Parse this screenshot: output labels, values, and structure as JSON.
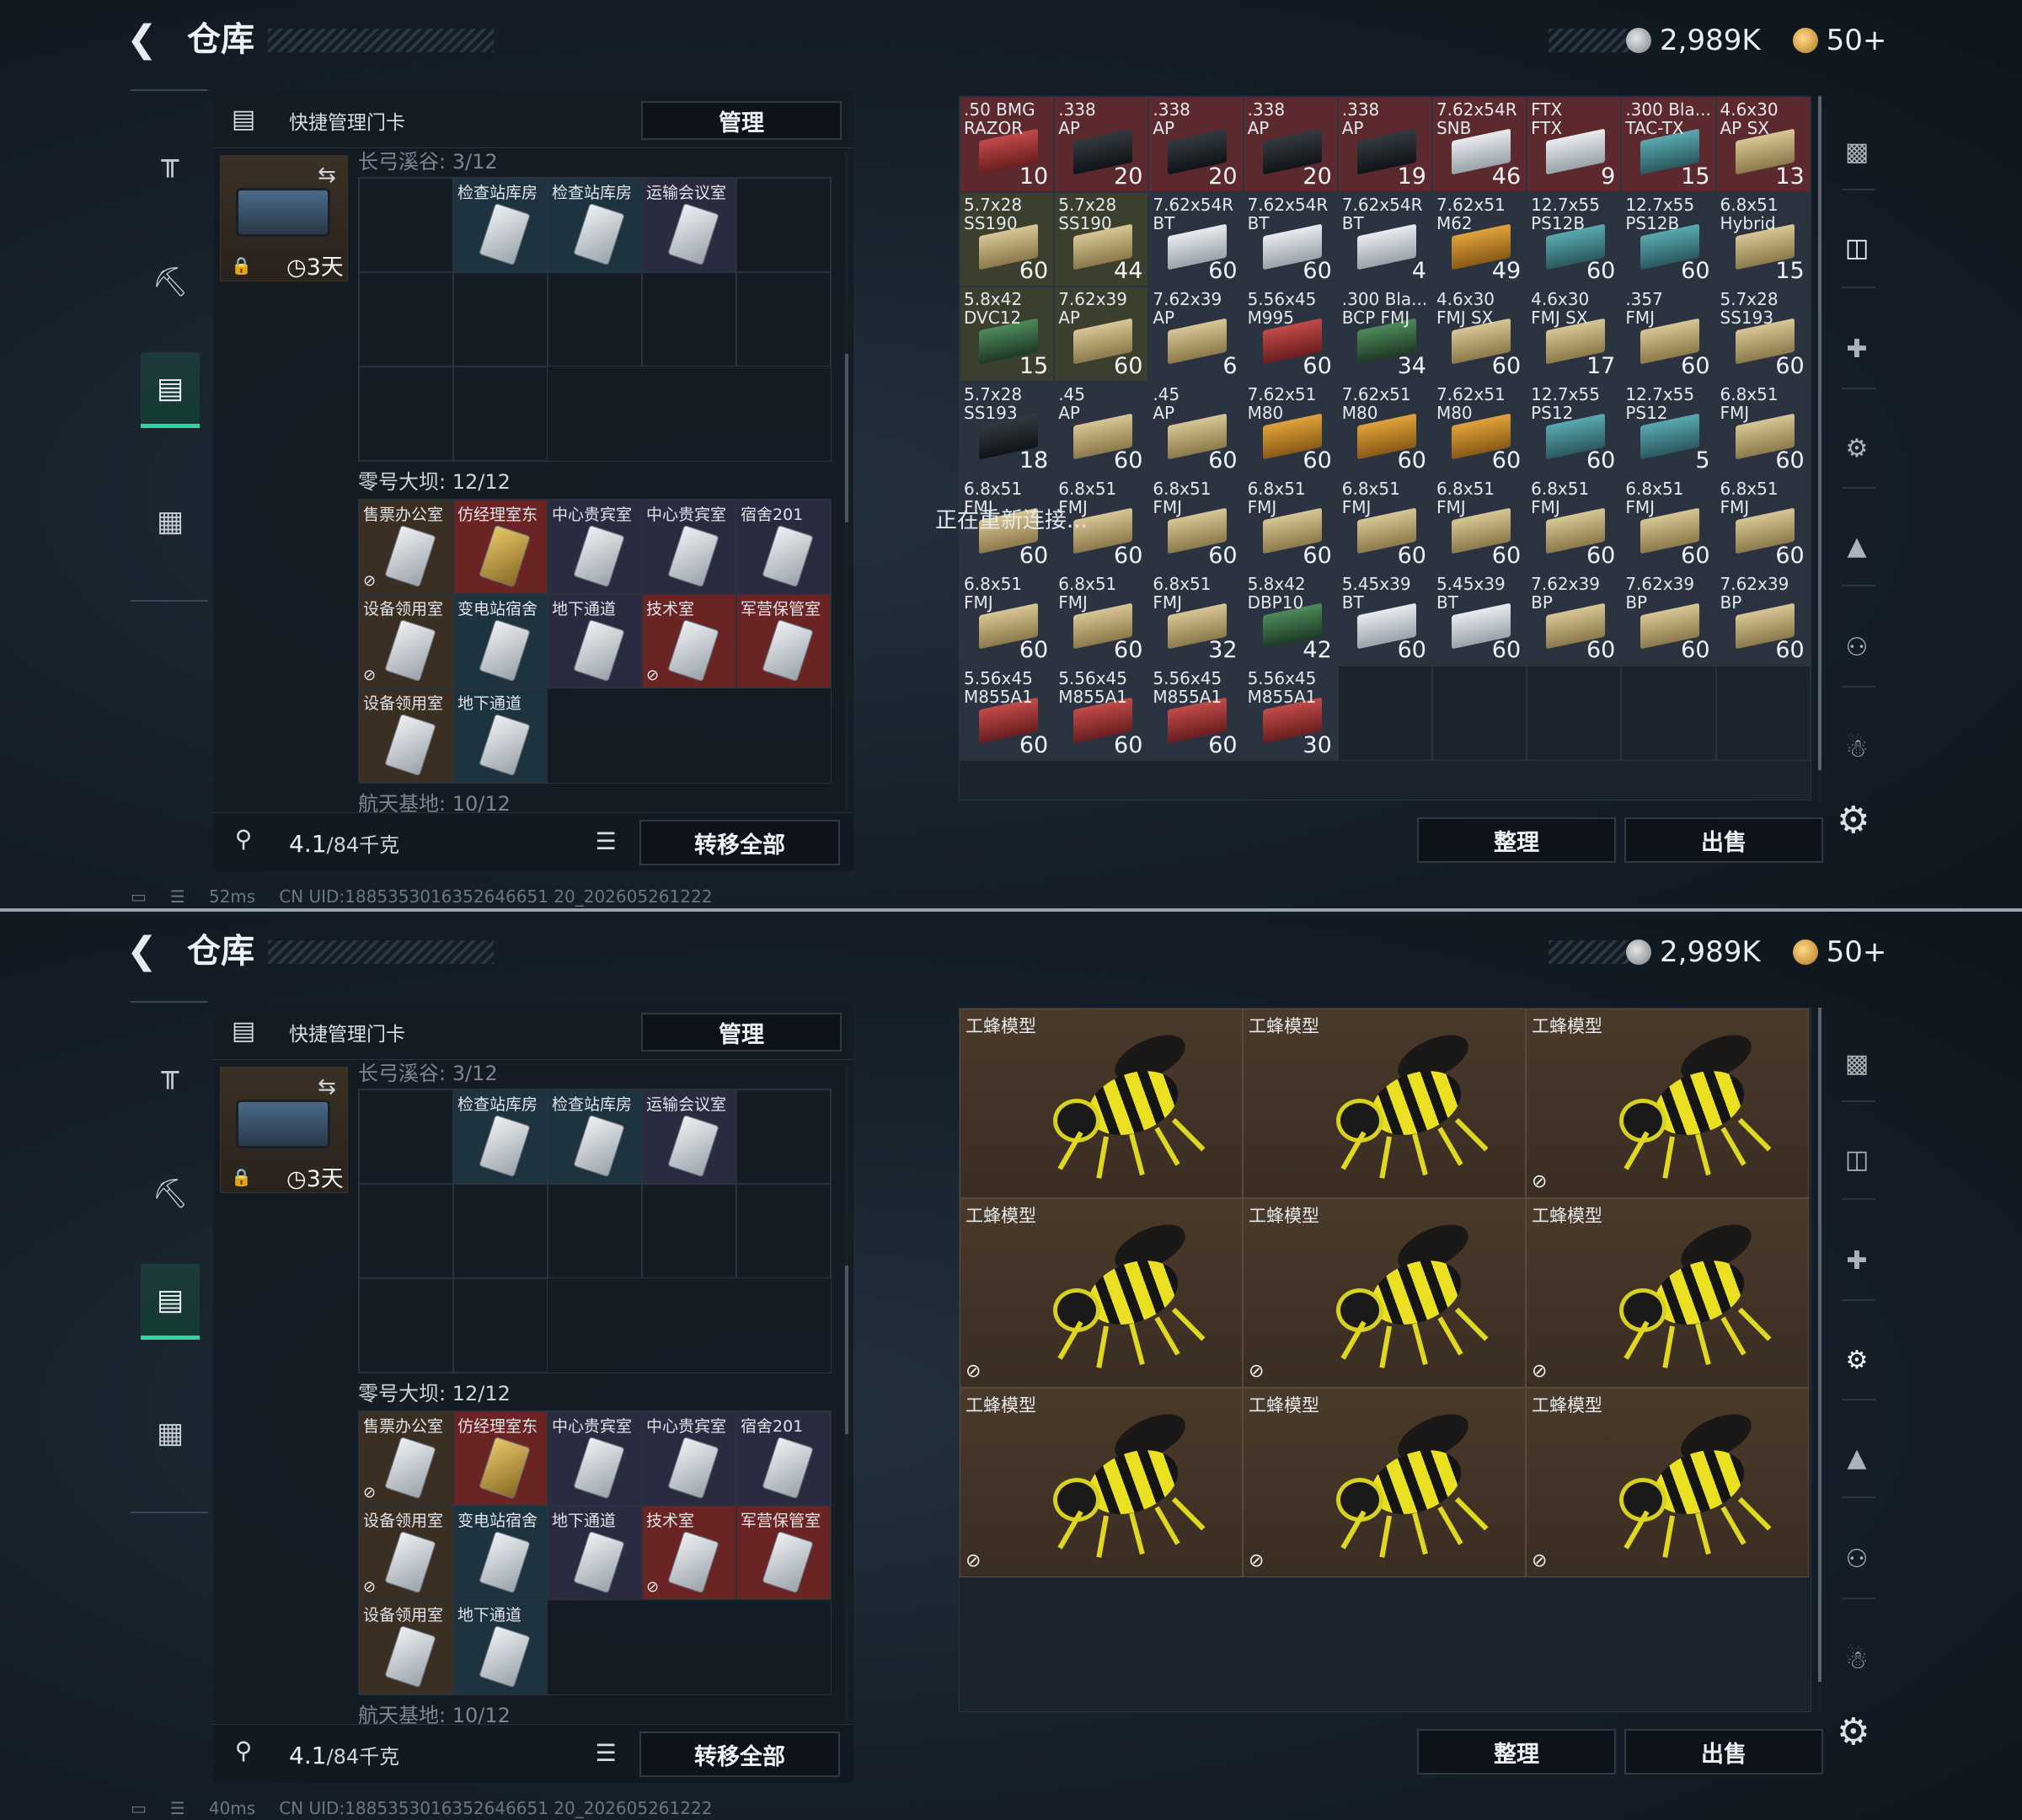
{
  "title": "仓库",
  "currency": {
    "silver": "2,989K",
    "gold": "50+"
  },
  "left_panel": {
    "header_label": "快捷管理门卡",
    "manage_label": "管理",
    "keycard_days": "3天",
    "zone1_label": "长弓溪谷: 3/12",
    "zone2_label": "零号大坝: 12/12",
    "zone3_label": "航天基地: 10/12",
    "weight": "4.1",
    "weight_total": "/84千克",
    "transfer_all_label": "转移全部"
  },
  "zone1_cards": [
    "",
    "检查站库房",
    "检查站库房",
    "运输会议室",
    "",
    "",
    "",
    "",
    "",
    "",
    "",
    ""
  ],
  "zone2_cards": [
    {
      "name": "售票办公室",
      "color": "brown",
      "nosell": true
    },
    {
      "name": "仿经理室东",
      "color": "red",
      "gold": true
    },
    {
      "name": "中心贵宾室",
      "color": "purple"
    },
    {
      "name": "中心贵宾室",
      "color": "purple"
    },
    {
      "name": "宿舍201",
      "color": "purple"
    },
    {
      "name": "设备领用室",
      "color": "brown",
      "nosell": true
    },
    {
      "name": "变电站宿舍",
      "color": "blue"
    },
    {
      "name": "地下通道",
      "color": "purple"
    },
    {
      "name": "技术室",
      "color": "red",
      "nosell": true
    },
    {
      "name": "军营保管室",
      "color": "red"
    },
    {
      "name": "设备领用室",
      "color": "brown"
    },
    {
      "name": "地下通道",
      "color": "blue"
    }
  ],
  "ammo": [
    {
      "name": ".50 BMG\nRAZOR",
      "count": "10",
      "bg": "r",
      "box": "red"
    },
    {
      "name": ".338\nAP",
      "count": "20",
      "bg": "r",
      "box": "black"
    },
    {
      "name": ".338\nAP",
      "count": "20",
      "bg": "r",
      "box": "black"
    },
    {
      "name": ".338\nAP",
      "count": "20",
      "bg": "r",
      "box": "black"
    },
    {
      "name": ".338\nAP",
      "count": "19",
      "bg": "r",
      "box": "black"
    },
    {
      "name": "7.62x54R\nSNB",
      "count": "46",
      "bg": "r",
      "box": "white"
    },
    {
      "name": "FTX\nFTX",
      "count": "9",
      "bg": "r",
      "box": "white"
    },
    {
      "name": ".300 Bla...\nTAC-TX",
      "count": "15",
      "bg": "r",
      "box": "teal"
    },
    {
      "name": "4.6x30\nAP SX",
      "count": "13",
      "bg": "r",
      "box": "tan"
    },
    {
      "name": "5.7x28\nSS190",
      "count": "60",
      "bg": "g",
      "box": "tan"
    },
    {
      "name": "5.7x28\nSS190",
      "count": "44",
      "bg": "g",
      "box": "tan"
    },
    {
      "name": "7.62x54R\nBT",
      "count": "60",
      "bg": "",
      "box": "white"
    },
    {
      "name": "7.62x54R\nBT",
      "count": "60",
      "bg": "",
      "box": "white"
    },
    {
      "name": "7.62x54R\nBT",
      "count": "4",
      "bg": "",
      "box": "white"
    },
    {
      "name": "7.62x51\nM62",
      "count": "49",
      "bg": "",
      "box": "orange"
    },
    {
      "name": "12.7x55\nPS12B",
      "count": "60",
      "bg": "",
      "box": "teal"
    },
    {
      "name": "12.7x55\nPS12B",
      "count": "60",
      "bg": "",
      "box": "teal"
    },
    {
      "name": "6.8x51\nHybrid",
      "count": "15",
      "bg": "",
      "box": "tan"
    },
    {
      "name": "5.8x42\nDVC12",
      "count": "15",
      "bg": "g",
      "box": "green"
    },
    {
      "name": "7.62x39\nAP",
      "count": "60",
      "bg": "g",
      "box": "tan"
    },
    {
      "name": "7.62x39\nAP",
      "count": "6",
      "bg": "",
      "box": "tan"
    },
    {
      "name": "5.56x45\nM995",
      "count": "60",
      "bg": "",
      "box": "red"
    },
    {
      "name": ".300 Bla...\nBCP FMJ",
      "count": "34",
      "bg": "",
      "box": "green"
    },
    {
      "name": "4.6x30\nFMJ SX",
      "count": "60",
      "bg": "",
      "box": "tan"
    },
    {
      "name": "4.6x30\nFMJ SX",
      "count": "17",
      "bg": "",
      "box": "tan"
    },
    {
      "name": ".357\nFMJ",
      "count": "60",
      "bg": "",
      "box": "tan"
    },
    {
      "name": "5.7x28\nSS193",
      "count": "60",
      "bg": "",
      "box": "tan"
    },
    {
      "name": "5.7x28\nSS193",
      "count": "18",
      "bg": "",
      "box": "black"
    },
    {
      "name": ".45\nAP",
      "count": "60",
      "bg": "",
      "box": "tan"
    },
    {
      "name": ".45\nAP",
      "count": "60",
      "bg": "",
      "box": "tan"
    },
    {
      "name": "7.62x51\nM80",
      "count": "60",
      "bg": "",
      "box": "orange"
    },
    {
      "name": "7.62x51\nM80",
      "count": "60",
      "bg": "",
      "box": "orange"
    },
    {
      "name": "7.62x51\nM80",
      "count": "60",
      "bg": "",
      "box": "orange"
    },
    {
      "name": "12.7x55\nPS12",
      "count": "60",
      "bg": "",
      "box": "teal"
    },
    {
      "name": "12.7x55\nPS12",
      "count": "5",
      "bg": "",
      "box": "teal"
    },
    {
      "name": "6.8x51\nFMJ",
      "count": "60",
      "bg": "",
      "box": "tan"
    },
    {
      "name": "6.8x51\nFMJ",
      "count": "60",
      "bg": "",
      "box": "tan"
    },
    {
      "name": "6.8x51\nFMJ",
      "count": "60",
      "bg": "",
      "box": "tan"
    },
    {
      "name": "6.8x51\nFMJ",
      "count": "60",
      "bg": "",
      "box": "tan"
    },
    {
      "name": "6.8x51\nFMJ",
      "count": "60",
      "bg": "",
      "box": "tan"
    },
    {
      "name": "6.8x51\nFMJ",
      "count": "60",
      "bg": "",
      "box": "tan"
    },
    {
      "name": "6.8x51\nFMJ",
      "count": "60",
      "bg": "",
      "box": "tan"
    },
    {
      "name": "6.8x51\nFMJ",
      "count": "60",
      "bg": "",
      "box": "tan"
    },
    {
      "name": "6.8x51\nFMJ",
      "count": "60",
      "bg": "",
      "box": "tan"
    },
    {
      "name": "6.8x51\nFMJ",
      "count": "60",
      "bg": "",
      "box": "tan"
    },
    {
      "name": "6.8x51\nFMJ",
      "count": "60",
      "bg": "",
      "box": "tan"
    },
    {
      "name": "6.8x51\nFMJ",
      "count": "60",
      "bg": "",
      "box": "tan"
    },
    {
      "name": "6.8x51\nFMJ",
      "count": "32",
      "bg": "",
      "box": "tan"
    },
    {
      "name": "5.8x42\nDBP10",
      "count": "42",
      "bg": "",
      "box": "green"
    },
    {
      "name": "5.45x39\nBT",
      "count": "60",
      "bg": "",
      "box": "white"
    },
    {
      "name": "5.45x39\nBT",
      "count": "60",
      "bg": "",
      "box": "white"
    },
    {
      "name": "7.62x39\nBP",
      "count": "60",
      "bg": "",
      "box": "tan"
    },
    {
      "name": "7.62x39\nBP",
      "count": "60",
      "bg": "",
      "box": "tan"
    },
    {
      "name": "7.62x39\nBP",
      "count": "60",
      "bg": "",
      "box": "tan"
    },
    {
      "name": "5.56x45\nM855A1",
      "count": "60",
      "bg": "",
      "box": "red"
    },
    {
      "name": "5.56x45\nM855A1",
      "count": "60",
      "bg": "",
      "box": "red"
    },
    {
      "name": "5.56x45\nM855A1",
      "count": "60",
      "bg": "",
      "box": "red"
    },
    {
      "name": "5.56x45\nM855A1",
      "count": "30",
      "bg": "",
      "box": "red"
    }
  ],
  "bees": [
    {
      "name": "工蜂模型",
      "nosell": false
    },
    {
      "name": "工蜂模型",
      "nosell": false
    },
    {
      "name": "工蜂模型",
      "nosell": true
    },
    {
      "name": "工蜂模型",
      "nosell": true
    },
    {
      "name": "工蜂模型",
      "nosell": true
    },
    {
      "name": "工蜂模型",
      "nosell": true
    },
    {
      "name": "工蜂模型",
      "nosell": true
    },
    {
      "name": "工蜂模型",
      "nosell": true
    },
    {
      "name": "工蜂模型",
      "nosell": true
    }
  ],
  "reconnect": "正在重新连接...",
  "right_panel": {
    "sort_label": "整理",
    "sell_label": "出售"
  },
  "status": [
    {
      "ping": "52ms",
      "uid": "CN UID:1885353016352646651 20_202605261222"
    },
    {
      "ping": "40ms",
      "uid": "CN UID:1885353016352646651 20_202605261222"
    }
  ],
  "icons": {
    "back": "chevron-left-icon",
    "gun": "pistol-icon",
    "vest": "armor-vest-icon",
    "card": "keycard-icon",
    "case": "briefcase-icon",
    "gear": "gear-icon"
  }
}
